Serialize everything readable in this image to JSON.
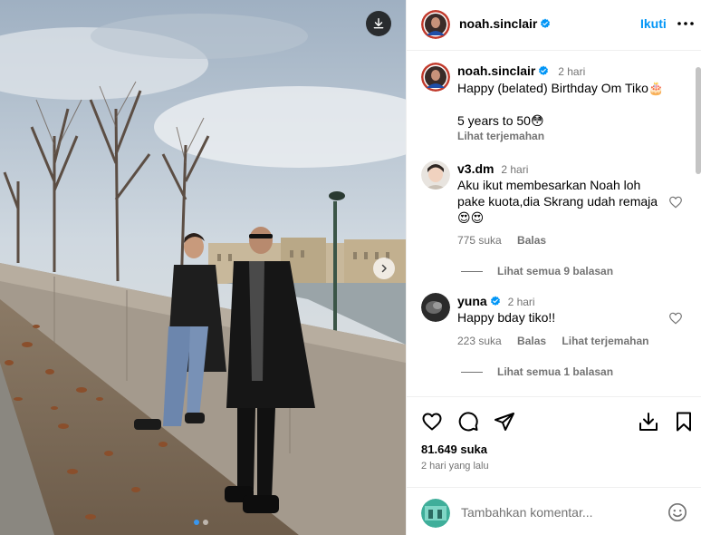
{
  "post": {
    "author": "noah.sinclair",
    "follow_label": "Ikuti",
    "caption_time": "2 hari",
    "caption_line1": "Happy (belated) Birthday Om Tiko🎂",
    "caption_line2": "5 years to 50😳",
    "translate_label": "Lihat terjemahan",
    "like_count": "81.649 suka",
    "posted_ago": "2 hari yang lalu",
    "photo_count": 2,
    "photo_index": 1
  },
  "comments": [
    {
      "username": "v3.dm",
      "verified": false,
      "time": "2 hari",
      "line1": "Aku ikut membesarkan Noah loh",
      "line2": "pake kuota,dia Skrang udah remaja",
      "line3": "😍😍",
      "likes": "775 suka",
      "reply_label": "Balas",
      "translate_label": "",
      "view_replies": "Lihat semua 9 balasan"
    },
    {
      "username": "yuna",
      "verified": true,
      "time": "2 hari",
      "line1": "Happy bday tiko!!",
      "likes": "223 suka",
      "reply_label": "Balas",
      "translate_label": "Lihat terjemahan",
      "view_replies": "Lihat semua 1 balasan"
    }
  ],
  "composer": {
    "placeholder": "Tambahkan komentar..."
  },
  "icons": {
    "download": "download-icon",
    "next": "chevron-right-icon",
    "verified": "verified-badge-icon",
    "more": "more-horizontal-icon",
    "like": "heart-icon",
    "comment": "comment-icon",
    "share": "paper-plane-icon",
    "download_post": "download-icon",
    "save": "bookmark-icon",
    "emoji": "emoji-icon"
  },
  "colors": {
    "accent": "#0095f6",
    "verified": "#0095f6",
    "muted": "#737373"
  }
}
